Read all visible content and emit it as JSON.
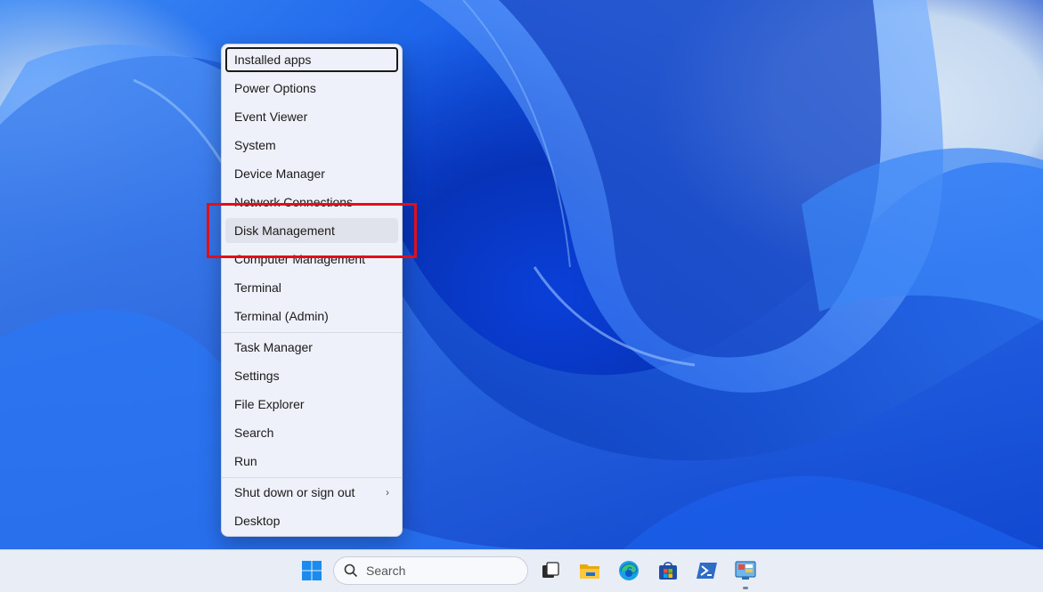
{
  "context_menu": {
    "items": [
      {
        "label": "Installed apps",
        "state": "focused"
      },
      {
        "label": "Power Options"
      },
      {
        "label": "Event Viewer"
      },
      {
        "label": "System"
      },
      {
        "label": "Device Manager"
      },
      {
        "label": "Network Connections"
      },
      {
        "label": "Disk Management",
        "state": "hover",
        "annotated": true
      },
      {
        "label": "Computer Management"
      },
      {
        "label": "Terminal"
      },
      {
        "label": "Terminal (Admin)"
      },
      {
        "label": "Task Manager"
      },
      {
        "label": "Settings"
      },
      {
        "label": "File Explorer"
      },
      {
        "label": "Search"
      },
      {
        "label": "Run"
      },
      {
        "label": "Shut down or sign out",
        "submenu": true
      },
      {
        "label": "Desktop"
      }
    ]
  },
  "annotation": {
    "color": "#e0101b",
    "target": "Disk Management"
  },
  "taskbar": {
    "search_placeholder": "Search",
    "icons": [
      "windows-start-icon",
      "search-icon",
      "task-view-icon",
      "file-explorer-icon",
      "edge-browser-icon",
      "microsoft-store-icon",
      "powershell-icon",
      "control-panel-icon"
    ],
    "accent": "#0078d4"
  }
}
